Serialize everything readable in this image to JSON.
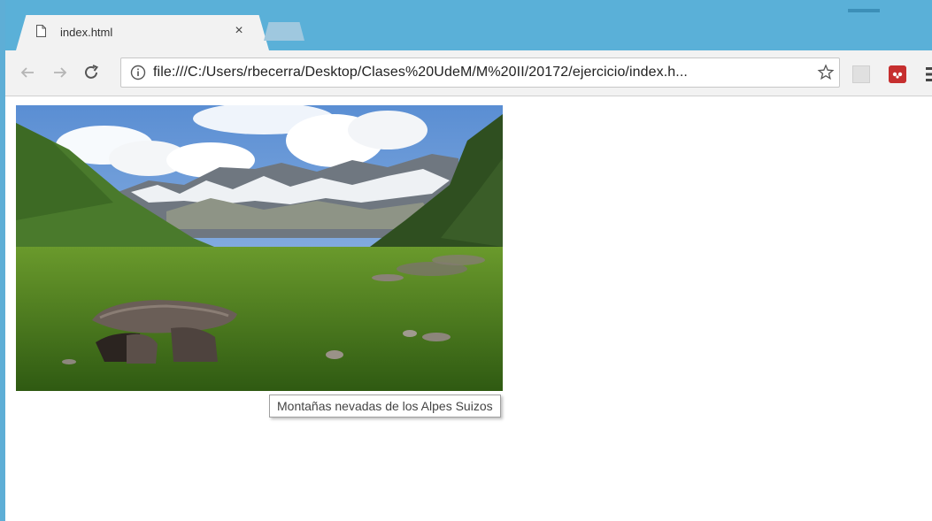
{
  "tab": {
    "title": "index.html",
    "close_glyph": "×",
    "icon": "document-icon"
  },
  "toolbar": {
    "back_icon": "back-arrow-icon",
    "forward_icon": "forward-arrow-icon",
    "reload_icon": "reload-icon"
  },
  "address_bar": {
    "url": "file:///C:/Users/rbecerra/Desktop/Clases%20UdeM/M%20II/20172/ejercicio/index.h...",
    "info_icon": "info-icon",
    "bookmark_icon": "star-icon"
  },
  "extensions": [
    "pdf-extension-icon",
    "mendeley-extension-icon",
    "menu-icon"
  ],
  "page": {
    "image_tooltip": "Montañas nevadas de los Alpes Suizos"
  },
  "colors": {
    "tabbar": "#5ab0d8",
    "toolbar": "#f2f2f2"
  }
}
